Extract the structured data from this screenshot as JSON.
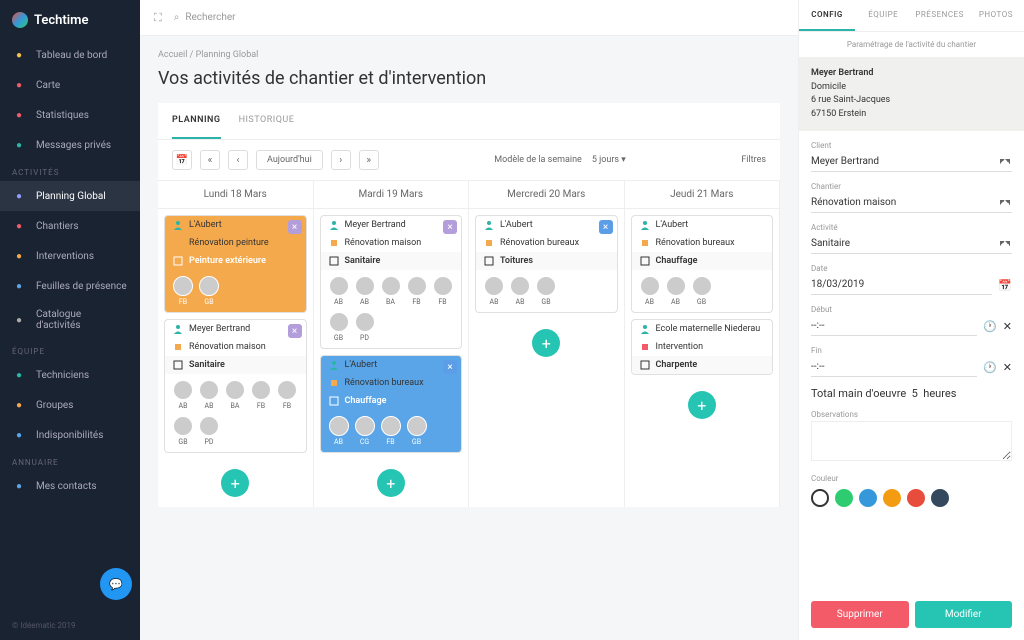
{
  "brand": "Techtime",
  "footer": "© Idéematic 2019",
  "topbar": {
    "search_placeholder": "Rechercher"
  },
  "nav": {
    "items_main": [
      {
        "label": "Tableau de bord",
        "icon": "dashboard",
        "color": "#f5c34b"
      },
      {
        "label": "Carte",
        "icon": "map",
        "color": "#f45b69"
      },
      {
        "label": "Statistiques",
        "icon": "stats",
        "color": "#f45b69"
      },
      {
        "label": "Messages privés",
        "icon": "chat",
        "color": "#2bb5a8"
      }
    ],
    "section_activites": "ACTIVITÉS",
    "items_activites": [
      {
        "label": "Planning Global",
        "icon": "calendar",
        "active": true,
        "color": "#8f9bff"
      },
      {
        "label": "Chantiers",
        "icon": "building",
        "color": "#f45b69"
      },
      {
        "label": "Interventions",
        "icon": "wrench",
        "color": "#f5a94d"
      },
      {
        "label": "Feuilles de présence",
        "icon": "clipboard",
        "color": "#5aa5e8"
      },
      {
        "label": "Catalogue d'activités",
        "icon": "list",
        "color": "#aaa"
      }
    ],
    "section_equipe": "ÉQUIPE",
    "items_equipe": [
      {
        "label": "Techniciens",
        "icon": "user",
        "color": "#2bb5a8"
      },
      {
        "label": "Groupes",
        "icon": "group",
        "color": "#f5a94d"
      },
      {
        "label": "Indisponibilités",
        "icon": "calendar-x",
        "color": "#5aa5e8"
      }
    ],
    "section_annuaire": "ANNUAIRE",
    "items_annuaire": [
      {
        "label": "Mes contacts",
        "icon": "contact",
        "color": "#5aa5e8"
      }
    ]
  },
  "breadcrumb": {
    "home": "Accueil",
    "current": "Planning Global"
  },
  "page_title": "Vos activités de chantier et d'intervention",
  "content_tabs": {
    "planning": "PLANNING",
    "historique": "HISTORIQUE"
  },
  "toolbar": {
    "today": "Aujourd'hui",
    "model_label": "Modèle de la semaine",
    "model_value": "5 jours",
    "filters": "Filtres"
  },
  "days": [
    {
      "label": "Lundi 18 Mars",
      "cards": [
        {
          "client": "L'Aubert",
          "project": "Rénovation peinture",
          "task": "Peinture extérieure",
          "task_color": "orange",
          "body": "orange",
          "close": "purple",
          "avatars": [
            "FB",
            "GB"
          ]
        },
        {
          "client": "Meyer Bertrand",
          "project": "Rénovation maison",
          "task": "Sanitaire",
          "close": "purple",
          "avatars": [
            "AB",
            "AB",
            "BA",
            "FB",
            "FB",
            "GB",
            "PD"
          ]
        }
      ]
    },
    {
      "label": "Mardi 19 Mars",
      "cards": [
        {
          "client": "Meyer Bertrand",
          "project": "Rénovation maison",
          "task": "Sanitaire",
          "close": "purple",
          "avatars": [
            "AB",
            "AB",
            "BA",
            "FB",
            "FB",
            "GB",
            "PD"
          ]
        },
        {
          "client": "L'Aubert",
          "project": "Rénovation bureaux",
          "task": "Chauffage",
          "task_color": "blue",
          "body": "blue",
          "close": "blue",
          "avatars": [
            "AB",
            "CG",
            "FB",
            "GB"
          ]
        }
      ]
    },
    {
      "label": "Mercredi 20 Mars",
      "cards": [
        {
          "client": "L'Aubert",
          "project": "Rénovation bureaux",
          "task": "Toitures",
          "close": "blue",
          "avatars": [
            "AB",
            "AB",
            "GB"
          ]
        }
      ]
    },
    {
      "label": "Jeudi 21 Mars",
      "cards": [
        {
          "client": "L'Aubert",
          "project": "Rénovation bureaux",
          "task": "Chauffage",
          "avatars": [
            "AB",
            "AB",
            "GB"
          ]
        },
        {
          "client": "Ecole maternelle Niederau",
          "project": "Intervention",
          "task": "Charpente",
          "is_intervention": true
        }
      ]
    }
  ],
  "panel": {
    "tabs": {
      "config": "CONFIG",
      "equipe": "ÉQUIPE",
      "presences": "PRÉSENCES",
      "photos": "PHOTOS"
    },
    "subtitle": "Paramétrage de l'activité du chantier",
    "contact": {
      "name": "Meyer Bertrand",
      "line1": "Domicile",
      "line2": "6 rue Saint-Jacques",
      "line3": "67150 Erstein"
    },
    "fields": {
      "client_label": "Client",
      "client_value": "Meyer Bertrand",
      "chantier_label": "Chantier",
      "chantier_value": "Rénovation maison",
      "activite_label": "Activité",
      "activite_value": "Sanitaire",
      "date_label": "Date",
      "date_value": "18/03/2019",
      "debut_label": "Début",
      "debut_value": "--:--",
      "fin_label": "Fin",
      "fin_value": "--:--",
      "total_label": "Total main d'oeuvre",
      "total_value": "5",
      "total_unit": "heures",
      "obs_label": "Observations",
      "color_label": "Couleur"
    },
    "colors": [
      "#ffffff",
      "#2ecc71",
      "#3498db",
      "#f39c12",
      "#e74c3c",
      "#34495e"
    ],
    "buttons": {
      "delete": "Supprimer",
      "modify": "Modifier"
    }
  }
}
